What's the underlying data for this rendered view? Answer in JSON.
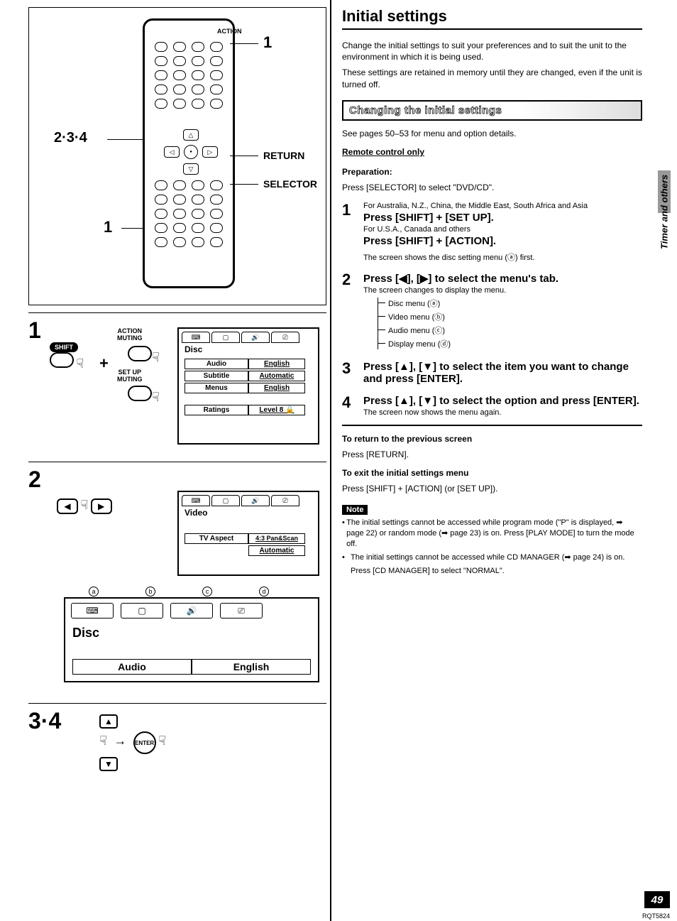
{
  "left": {
    "callouts": {
      "one_top": "1",
      "two_three_four": "2·3·4",
      "return": "RETURN",
      "selector": "SELECTOR",
      "one_bottom": "1",
      "action": "ACTION"
    },
    "panel1": {
      "num": "1",
      "shift": "SHIFT",
      "plus": "+",
      "action_muting": "ACTION\nMUTING",
      "setup_muting": "SET UP\nMUTING",
      "osd_title": "Disc",
      "rows": [
        {
          "l": "Audio",
          "r": "English"
        },
        {
          "l": "Subtitle",
          "r": "Automatic"
        },
        {
          "l": "Menus",
          "r": "English"
        }
      ],
      "ratings_row": {
        "l": "Ratings",
        "r": "Level 8 🔒"
      }
    },
    "panel2": {
      "num": "2",
      "osd_title": "Video",
      "rows": [
        {
          "l": "TV Aspect",
          "r": "4:3 Pan&Scan"
        },
        {
          "l": "",
          "r": "Automatic"
        }
      ],
      "labels": {
        "a": "a",
        "b": "b",
        "c": "c",
        "d": "d"
      },
      "big_title": "Disc",
      "big_row": {
        "l": "Audio",
        "r": "English"
      }
    },
    "panel34": {
      "num": "3·4",
      "enter": "ENTER",
      "arrow": "→"
    }
  },
  "right": {
    "title": "Initial settings",
    "intro1": "Change the initial settings to suit your preferences and to suit the unit to the environment in which it is being used.",
    "intro2": "These settings are retained in memory until they are changed, even if the unit is turned off.",
    "subhead": "Changing the initial settings",
    "seepages": "See pages 50–53 for menu and option details.",
    "remote_only": "Remote control only",
    "prep_h": "Preparation:",
    "prep_t": "Press [SELECTOR] to select \"DVD/CD\".",
    "step1": {
      "num": "1",
      "regionA": "For Australia, N.Z., China, the Middle East, South Africa and Asia",
      "pressA": "Press [SHIFT] + [SET UP].",
      "regionB": "For U.S.A., Canada and others",
      "pressB": "Press [SHIFT] + [ACTION].",
      "note": "The screen shows the disc setting menu (ⓐ) first."
    },
    "step2": {
      "num": "2",
      "h": "Press [◀], [▶] to select the menu's tab.",
      "sub": "The screen changes to display the menu.",
      "tree": {
        "disc": "Disc menu (ⓐ)",
        "video": "Video menu (ⓑ)",
        "audio": "Audio menu (ⓒ)",
        "display": "Display menu (ⓓ)"
      }
    },
    "step3": {
      "num": "3",
      "h": "Press [▲], [▼] to select the item you want to change and press [ENTER]."
    },
    "step4": {
      "num": "4",
      "h": "Press [▲], [▼] to select the option and press [ENTER].",
      "sub": "The screen now shows the menu again."
    },
    "return_h": "To return to the previous screen",
    "return_t": "Press [RETURN].",
    "exit_h": "To exit the initial settings menu",
    "exit_t": "Press [SHIFT] + [ACTION] (or [SET UP]).",
    "note_label": "Note",
    "note1": "The initial settings cannot be accessed while program mode (\"P\" is displayed, ➡ page 22) or random mode (➡ page 23) is on. Press [PLAY MODE] to turn the mode off.",
    "note2": "The initial settings cannot be accessed while CD MANAGER (➡ page 24) is on.",
    "note2b": "Press [CD MANAGER] to select \"NORMAL\".",
    "sidetab": "Timer and others",
    "page": "49",
    "doccode": "RQT5824"
  }
}
